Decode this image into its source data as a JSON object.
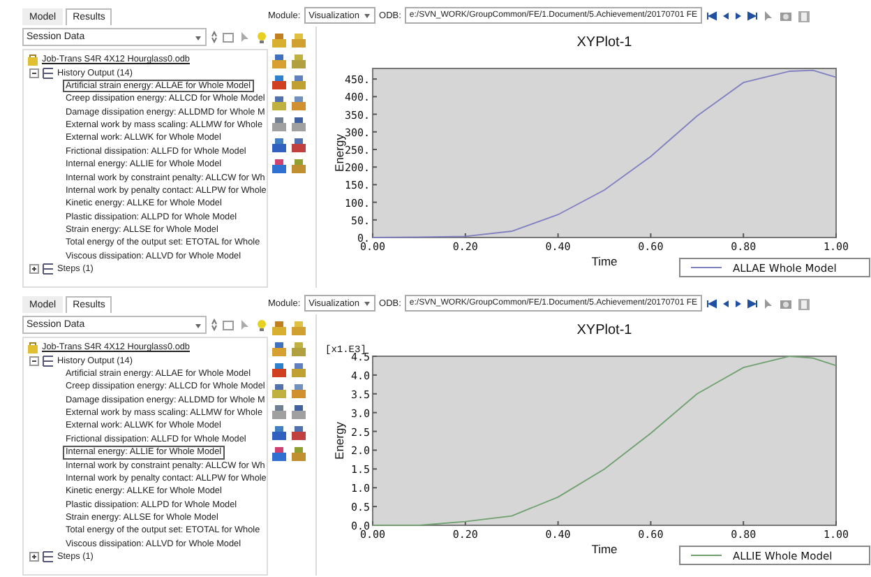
{
  "panels": [
    {
      "tabs": [
        {
          "label": "Model",
          "selected": false
        },
        {
          "label": "Results",
          "selected": true
        }
      ],
      "session_combo": {
        "value": "Session Data"
      },
      "tree": {
        "label": "Job-Trans S4R 4X12 Hourglass0.odb",
        "children": [
          {
            "label": "History Output (14)",
            "expanded": true,
            "children": [
              {
                "label": "Artificial strain energy: ALLAE for Whole Model",
                "selected": true
              },
              {
                "label": "Creep dissipation energy: ALLCD for Whole Model",
                "selected": false
              },
              {
                "label": "Damage dissipation energy: ALLDMD for Whole M",
                "selected": false
              },
              {
                "label": "External work by mass scaling: ALLMW for Whole",
                "selected": false
              },
              {
                "label": "External work: ALLWK for Whole Model",
                "selected": false
              },
              {
                "label": "Frictional dissipation: ALLFD for Whole Model",
                "selected": false
              },
              {
                "label": "Internal energy: ALLIE for Whole Model",
                "selected": false
              },
              {
                "label": "Internal work by constraint penalty: ALLCW for Wh",
                "selected": false
              },
              {
                "label": "Internal work by penalty contact: ALLPW for Whole",
                "selected": false
              },
              {
                "label": "Kinetic energy: ALLKE for Whole Model",
                "selected": false
              },
              {
                "label": "Plastic dissipation: ALLPD for Whole Model",
                "selected": false
              },
              {
                "label": "Strain energy: ALLSE for Whole Model",
                "selected": false
              },
              {
                "label": "Total energy of the output set: ETOTAL for Whole",
                "selected": false
              },
              {
                "label": "Viscous dissipation: ALLVD for Whole Model",
                "selected": false
              }
            ]
          },
          {
            "label": "Steps (1)",
            "expanded": false
          }
        ]
      },
      "module": {
        "label": "Module:",
        "value": "Visualization"
      },
      "odb": {
        "label": "ODB:",
        "value": "e:/SVN_WORK/GroupCommon/FE/1.Document/5.Achievement/20170701 FE"
      },
      "plot": {
        "chart_data": {
          "type": "line",
          "title": "XYPlot-1",
          "xlabel": "Time",
          "ylabel": "Energy",
          "x": [
            0,
            0.1,
            0.2,
            0.3,
            0.4,
            0.5,
            0.6,
            0.7,
            0.8,
            0.9,
            0.95,
            1.0
          ],
          "series": [
            {
              "name": "ALLAE Whole Model",
              "color": "#8080c0",
              "values": [
                0,
                1,
                3,
                18,
                65,
                135,
                230,
                345,
                440,
                472,
                475,
                455
              ]
            }
          ],
          "xlim": [
            0,
            1
          ],
          "ylim": [
            0,
            480
          ],
          "xticks": [
            {
              "value": 0,
              "label": "0.00"
            },
            {
              "value": 0.2,
              "label": "0.20"
            },
            {
              "value": 0.4,
              "label": "0.40"
            },
            {
              "value": 0.6,
              "label": "0.60"
            },
            {
              "value": 0.8,
              "label": "0.80"
            },
            {
              "value": 1,
              "label": "1.00"
            }
          ],
          "yticks": [
            {
              "value": 0,
              "label": "0."
            },
            {
              "value": 50,
              "label": "50."
            },
            {
              "value": 100,
              "label": "100."
            },
            {
              "value": 150,
              "label": "150."
            },
            {
              "value": 200,
              "label": "200."
            },
            {
              "value": 250,
              "label": "250."
            },
            {
              "value": 300,
              "label": "300."
            },
            {
              "value": 350,
              "label": "350."
            },
            {
              "value": 400,
              "label": "400."
            },
            {
              "value": 450,
              "label": "450."
            }
          ]
        }
      }
    },
    {
      "tabs": [
        {
          "label": "Model",
          "selected": false
        },
        {
          "label": "Results",
          "selected": true
        }
      ],
      "session_combo": {
        "value": "Session Data"
      },
      "tree": {
        "label": "Job-Trans S4R 4X12 Hourglass0.odb",
        "children": [
          {
            "label": "History Output (14)",
            "expanded": true,
            "children": [
              {
                "label": "Artificial strain energy: ALLAE for Whole Model",
                "selected": false
              },
              {
                "label": "Creep dissipation energy: ALLCD for Whole Model",
                "selected": false
              },
              {
                "label": "Damage dissipation energy: ALLDMD for Whole M",
                "selected": false
              },
              {
                "label": "External work by mass scaling: ALLMW for Whole",
                "selected": false
              },
              {
                "label": "External work: ALLWK for Whole Model",
                "selected": false
              },
              {
                "label": "Frictional dissipation: ALLFD for Whole Model",
                "selected": false
              },
              {
                "label": "Internal energy: ALLIE for Whole Model",
                "selected": true
              },
              {
                "label": "Internal work by constraint penalty: ALLCW for Wh",
                "selected": false
              },
              {
                "label": "Internal work by penalty contact: ALLPW for Whole",
                "selected": false
              },
              {
                "label": "Kinetic energy: ALLKE for Whole Model",
                "selected": false
              },
              {
                "label": "Plastic dissipation: ALLPD for Whole Model",
                "selected": false
              },
              {
                "label": "Strain energy: ALLSE for Whole Model",
                "selected": false
              },
              {
                "label": "Total energy of the output set: ETOTAL for Whole",
                "selected": false
              },
              {
                "label": "Viscous dissipation: ALLVD for Whole Model",
                "selected": false
              }
            ]
          },
          {
            "label": "Steps (1)",
            "expanded": false
          }
        ]
      },
      "module": {
        "label": "Module:",
        "value": "Visualization"
      },
      "odb": {
        "label": "ODB:",
        "value": "e:/SVN_WORK/GroupCommon/FE/1.Document/5.Achievement/20170701 FE"
      },
      "plot": {
        "scale_label": "[x1.E3]",
        "chart_data": {
          "type": "line",
          "title": "XYPlot-1",
          "xlabel": "Time",
          "ylabel": "Energy",
          "x": [
            0,
            0.1,
            0.2,
            0.3,
            0.4,
            0.5,
            0.6,
            0.7,
            0.8,
            0.9,
            0.95,
            1.0
          ],
          "series": [
            {
              "name": "ALLIE Whole Model",
              "color": "#70a070",
              "values": [
                0,
                0,
                0.1,
                0.25,
                0.75,
                1.5,
                2.45,
                3.5,
                4.2,
                4.5,
                4.45,
                4.25
              ]
            }
          ],
          "xlim": [
            0,
            1
          ],
          "ylim": [
            0,
            4.5
          ],
          "xticks": [
            {
              "value": 0,
              "label": "0.00"
            },
            {
              "value": 0.2,
              "label": "0.20"
            },
            {
              "value": 0.4,
              "label": "0.40"
            },
            {
              "value": 0.6,
              "label": "0.60"
            },
            {
              "value": 0.8,
              "label": "0.80"
            },
            {
              "value": 1,
              "label": "1.00"
            }
          ],
          "yticks": [
            {
              "value": 0,
              "label": "0.0"
            },
            {
              "value": 0.5,
              "label": "0.5"
            },
            {
              "value": 1,
              "label": "1.0"
            },
            {
              "value": 1.5,
              "label": "1.5"
            },
            {
              "value": 2,
              "label": "2.0"
            },
            {
              "value": 2.5,
              "label": "2.5"
            },
            {
              "value": 3,
              "label": "3.0"
            },
            {
              "value": 3.5,
              "label": "3.5"
            },
            {
              "value": 4,
              "label": "4.0"
            },
            {
              "value": 4.5,
              "label": "4.5"
            }
          ]
        }
      }
    }
  ]
}
